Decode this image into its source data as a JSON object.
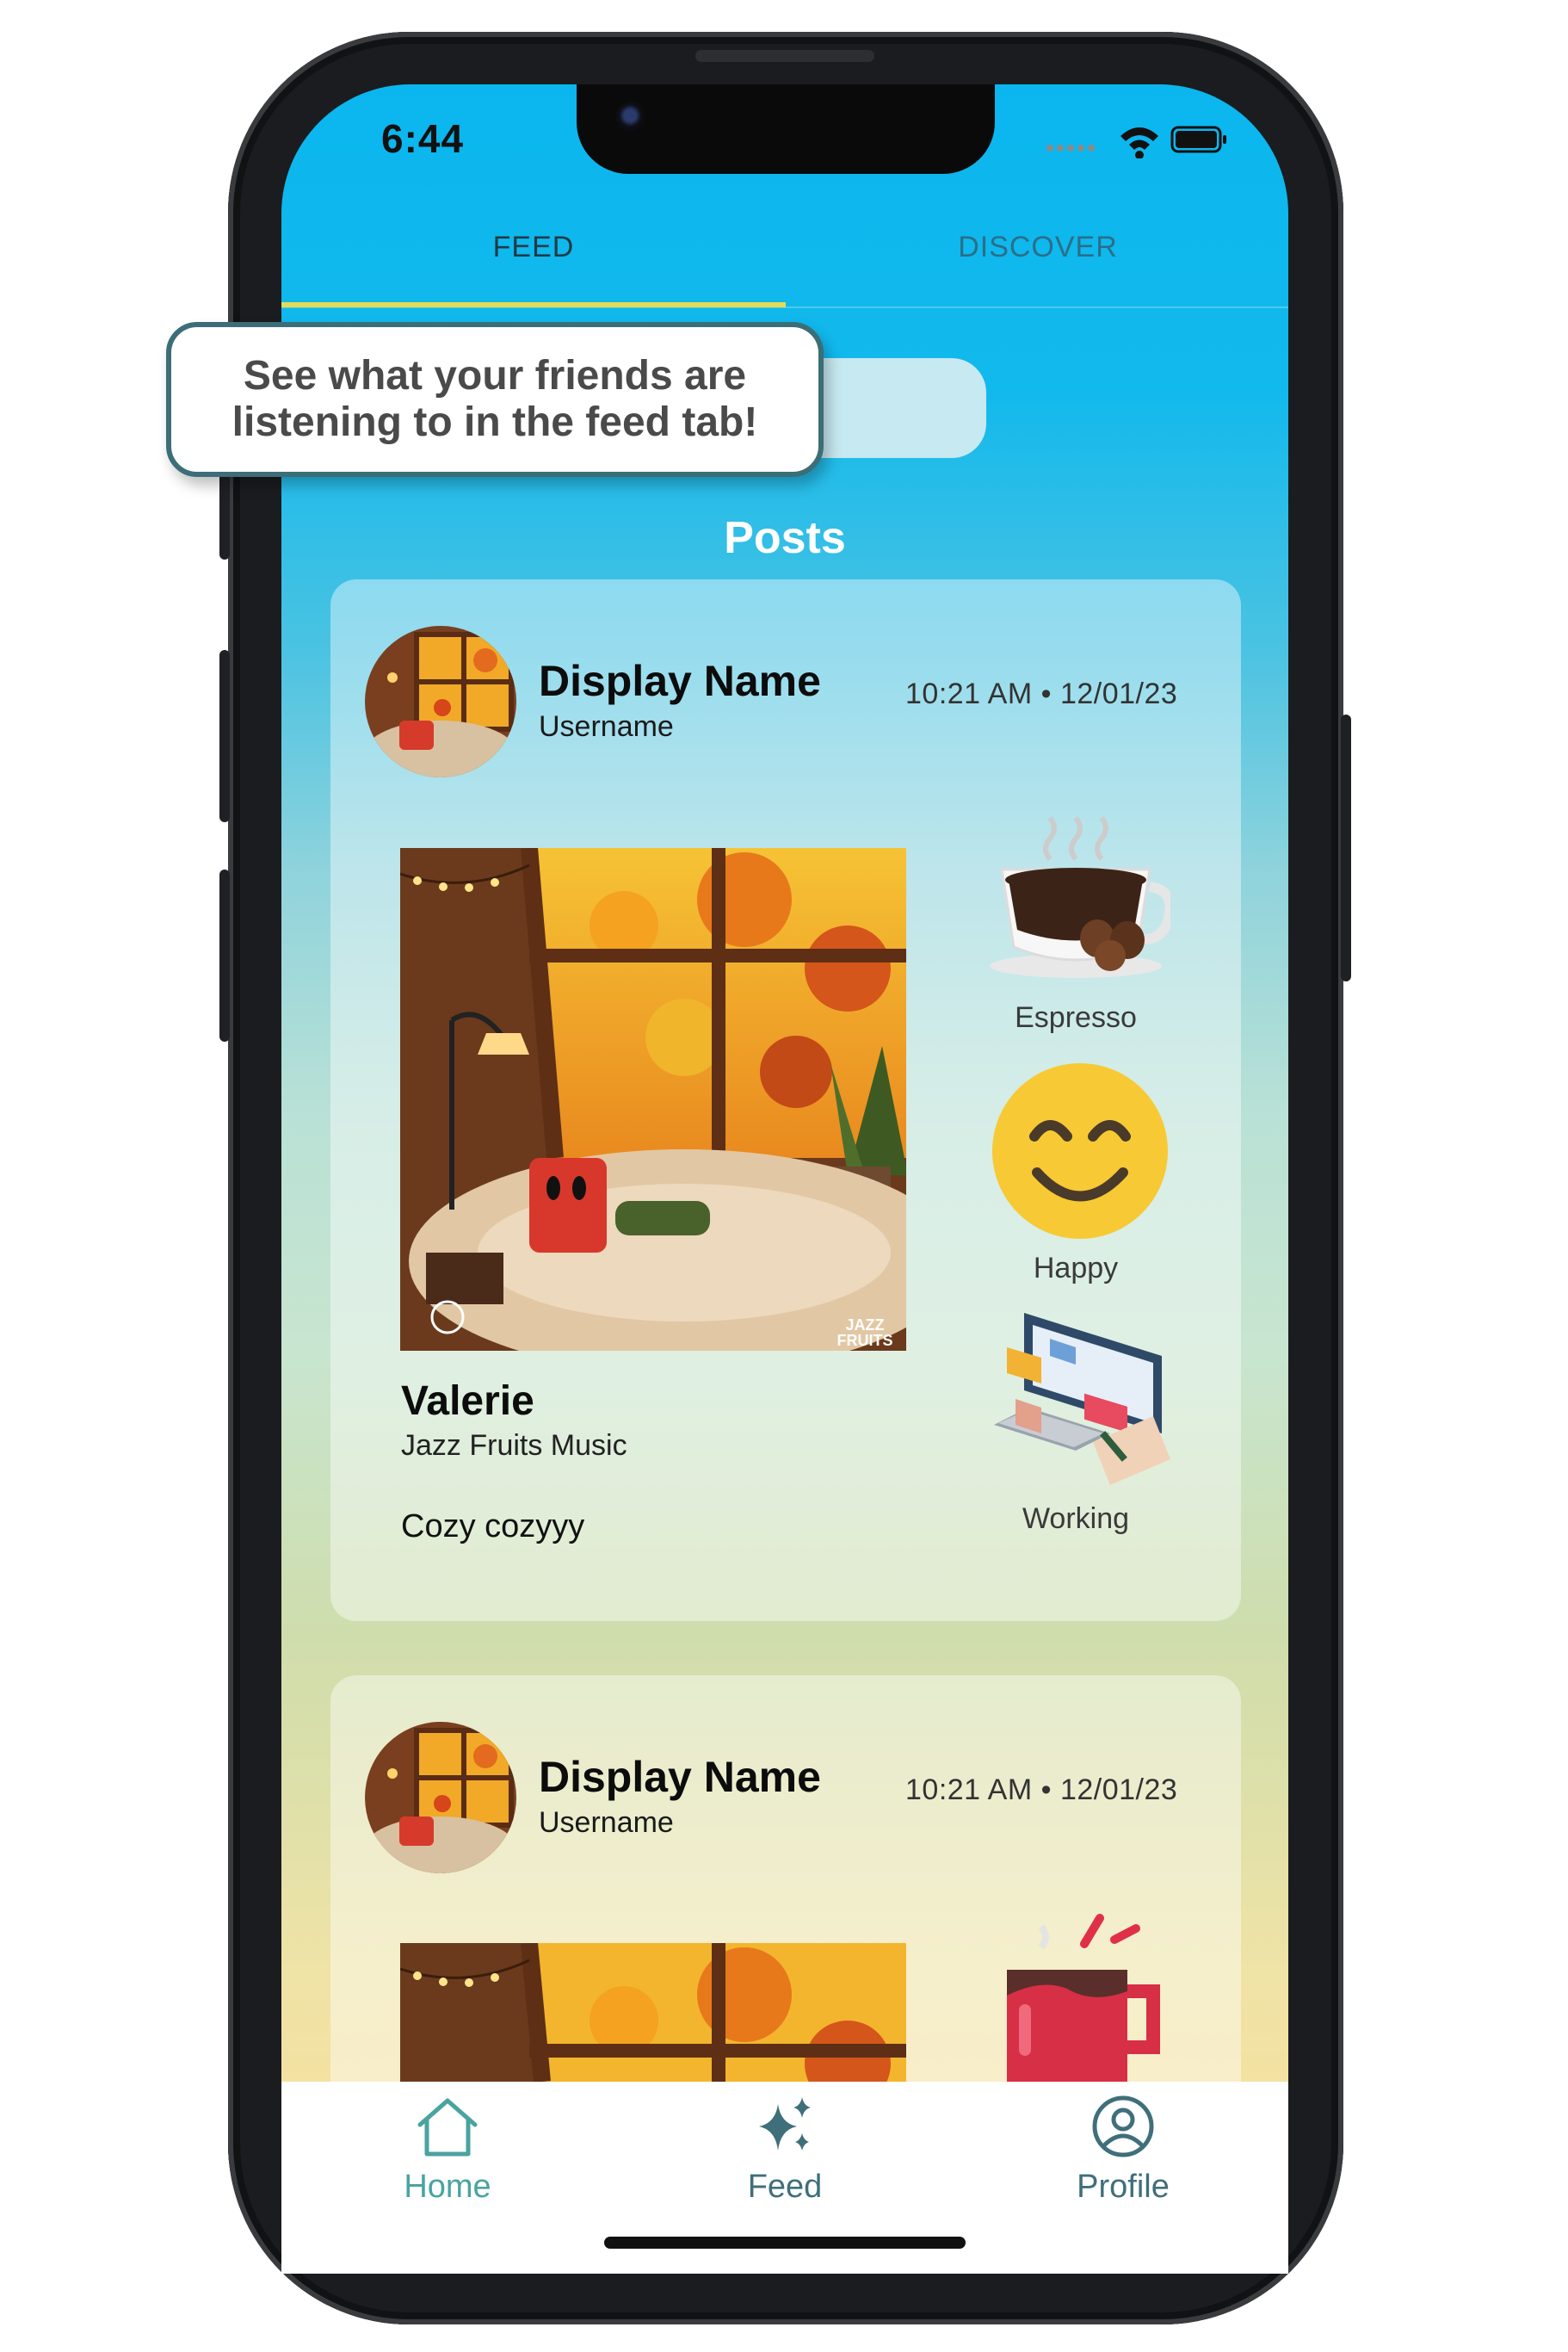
{
  "status_bar": {
    "time": "6:44"
  },
  "top_tabs": [
    {
      "label": "FEED",
      "active": true
    },
    {
      "label": "DISCOVER",
      "active": false
    }
  ],
  "tooltip": {
    "text": "See what your friends are listening to in the feed tab!"
  },
  "posts_title": "Posts",
  "posts": [
    {
      "display_name": "Display Name",
      "username": "Username",
      "timestamp": "10:21 AM • 12/01/23",
      "song_title": "Valerie",
      "artist": "Jazz Fruits Music",
      "caption": "Cozy cozyyy",
      "album_badge": "JAZZ\nFRUITS",
      "moods": [
        {
          "label": "Espresso",
          "icon": "espresso-cup-icon"
        },
        {
          "label": "Happy",
          "icon": "smiling-face-icon"
        },
        {
          "label": "Working",
          "icon": "computer-desk-icon"
        }
      ]
    },
    {
      "display_name": "Display Name",
      "username": "Username",
      "timestamp": "10:21 AM • 12/01/23",
      "moods": [
        {
          "label": "",
          "icon": "red-mug-icon"
        }
      ]
    }
  ],
  "bottom_nav": [
    {
      "label": "Home",
      "icon": "home-icon",
      "active": true
    },
    {
      "label": "Feed",
      "icon": "sparkles-icon",
      "active": false
    },
    {
      "label": "Profile",
      "icon": "profile-icon",
      "active": false
    }
  ],
  "colors": {
    "header_blue": "#0bb6ee",
    "tab_underline": "#e3dc55",
    "active_nav": "#4aa3a0",
    "inactive_nav": "#3f6f7a",
    "tooltip_border": "#3c6e78"
  }
}
